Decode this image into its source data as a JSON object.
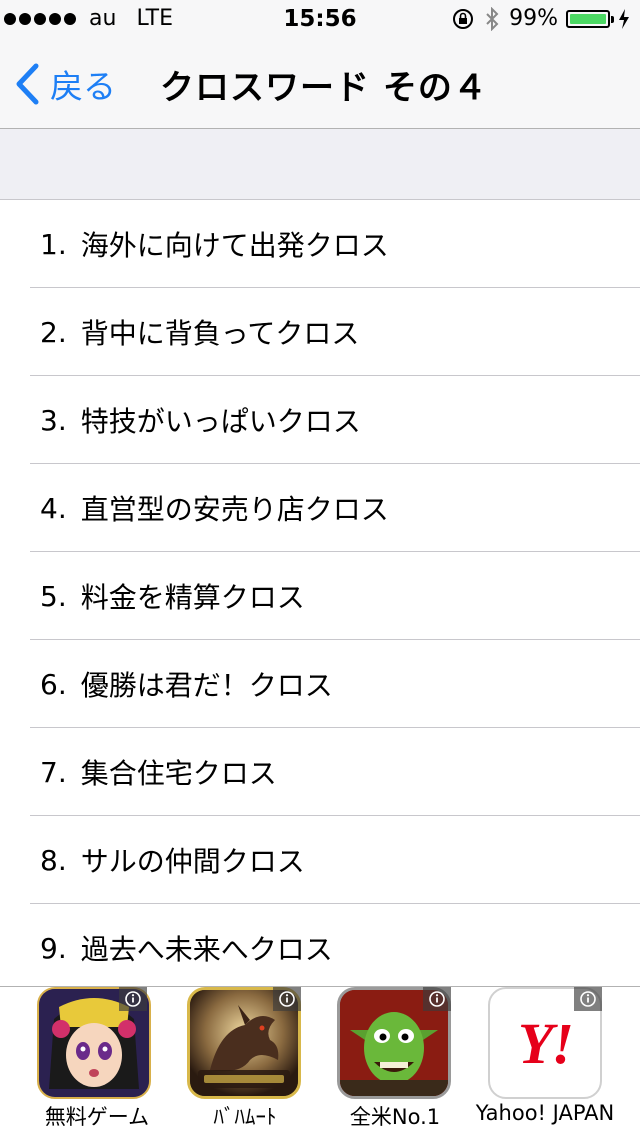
{
  "status_bar": {
    "carrier": "au",
    "network": "LTE",
    "time": "15:56",
    "battery_percent": "99%",
    "battery_level": 0.99,
    "battery_color": "#4cd964"
  },
  "nav": {
    "back_label": "戻る",
    "title": "クロスワード その４",
    "accent_color": "#1e7ff5"
  },
  "list": {
    "items": [
      {
        "num": "1.",
        "label": "海外に向けて出発クロス"
      },
      {
        "num": "2.",
        "label": "背中に背負ってクロス"
      },
      {
        "num": "3.",
        "label": "特技がいっぱいクロス"
      },
      {
        "num": "4.",
        "label": "直営型の安売り店クロス"
      },
      {
        "num": "5.",
        "label": "料金を精算クロス"
      },
      {
        "num": "6.",
        "label": "優勝は君だ！クロス"
      },
      {
        "num": "7.",
        "label": "集合住宅クロス"
      },
      {
        "num": "8.",
        "label": "サルの仲間クロス"
      },
      {
        "num": "9.",
        "label": "過去へ未来へクロス"
      }
    ]
  },
  "ads": [
    {
      "label": "無料ゲーム",
      "icon": "anime-girl-game-icon"
    },
    {
      "label": "ﾊﾞﾊﾑｰﾄ",
      "icon": "dragon-game-icon"
    },
    {
      "label": "全米No.1",
      "icon": "goblin-game-icon"
    },
    {
      "label": "Yahoo! JAPAN",
      "icon": "yahoo-japan-icon",
      "logo_text": "Y!"
    }
  ]
}
